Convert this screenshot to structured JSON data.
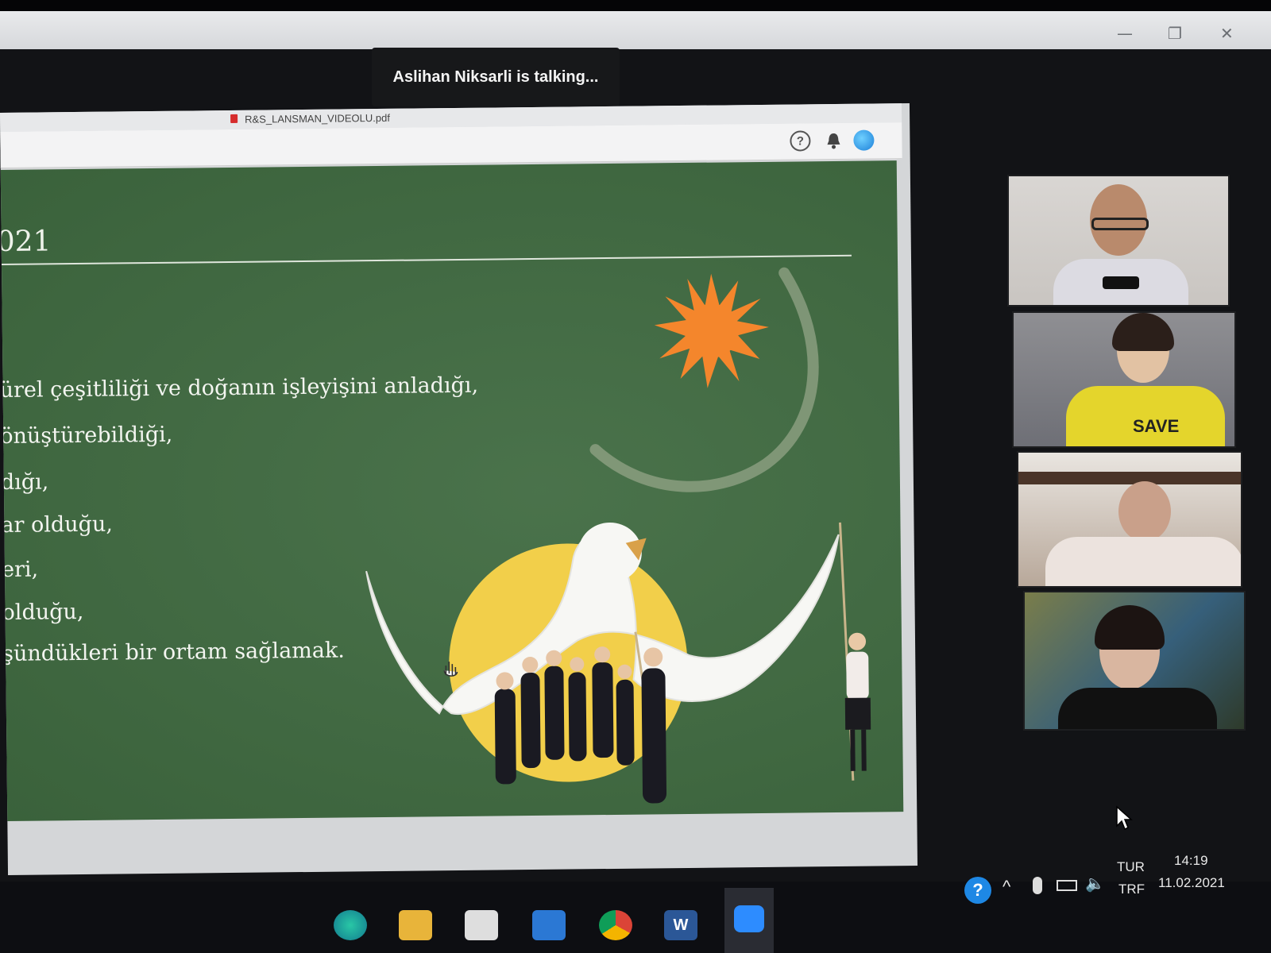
{
  "meeting": {
    "talking_indicator": "Aslihan Niksarli is talking...",
    "window_controls": {
      "minimize": "—",
      "restore": "❐",
      "close": "✕"
    }
  },
  "shared_window": {
    "tab_filename": "R&S_LANSMAN_VIDEOLU.pdf",
    "toolbar_icons": [
      "help-icon",
      "bell-icon",
      "account-avatar-icon"
    ],
    "slide": {
      "year_fragment": "021",
      "lines": [
        "ürel çeşitliliği ve doğanın işleyişini anladığı,",
        "önüştürebildiği,",
        "dığı,",
        "ar olduğu,",
        "eri,",
        "olduğu,",
        "şündükleri bir ortam sağlamak."
      ],
      "colors": {
        "background": "#3f6a40",
        "sun": "#f4862c",
        "circle": "#f2cf4a",
        "arc": "#9aa88a"
      }
    }
  },
  "participants": {
    "count_visible": 4,
    "tile_2_shirt_text": "SAVE"
  },
  "taskbar": {
    "tray": {
      "lang_top": "TUR",
      "lang_bottom": "TRF",
      "time": "14:19",
      "date": "11.02.2021"
    },
    "apps": [
      "edge-icon",
      "file-explorer-icon",
      "store-icon",
      "mail-icon",
      "chrome-icon",
      "word-icon",
      "zoom-icon"
    ]
  }
}
